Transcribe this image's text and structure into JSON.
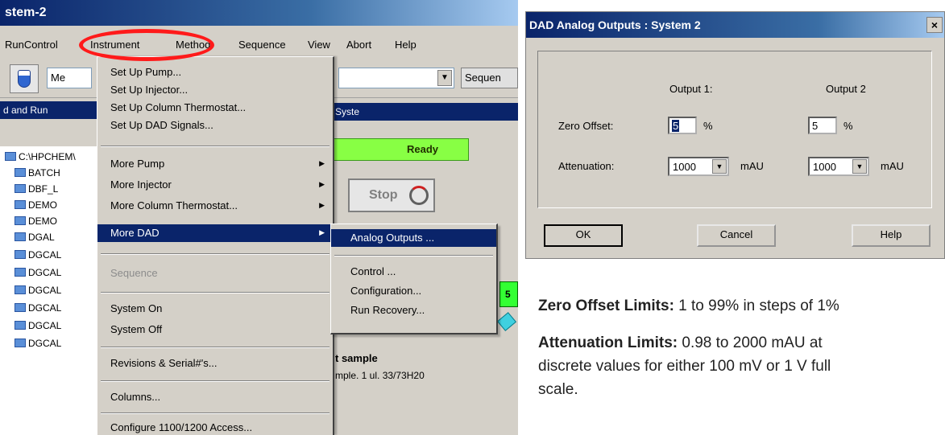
{
  "main_window": {
    "title": "stem-2",
    "menu": [
      "RunControl",
      "Instrument",
      "Method",
      "Sequence",
      "View",
      "Abort",
      "Help"
    ],
    "toolbar": {
      "method_combo": "Me",
      "sequence_button": "Sequen"
    },
    "left_panel_header": "d and Run",
    "right_panel_header": "Syste",
    "tree_items": [
      "C:\\HPCHEM\\",
      "BATCH",
      "DBF_L",
      "DEMO",
      "DEMO",
      "DGAL",
      "DGCAL",
      "DGCAL",
      "DGCAL",
      "DGCAL",
      "DGCAL",
      "DGCAL"
    ],
    "status": "Ready",
    "stop_label": "Stop",
    "green_indicator": "5",
    "sample_title": "t sample",
    "sample_detail": "mple. 1 ul. 33/73H20"
  },
  "instrument_menu": {
    "items": [
      {
        "label": "Set Up Pump...",
        "submenu": false,
        "disabled": false
      },
      {
        "label": "Set Up Injector...",
        "submenu": false,
        "disabled": false
      },
      {
        "label": "Set Up Column Thermostat...",
        "submenu": false,
        "disabled": false
      },
      {
        "label": "Set Up DAD Signals...",
        "submenu": false,
        "disabled": false
      },
      {
        "label": "More Pump",
        "submenu": true,
        "disabled": false
      },
      {
        "label": "More Injector",
        "submenu": true,
        "disabled": false
      },
      {
        "label": "More Column Thermostat...",
        "submenu": true,
        "disabled": false
      },
      {
        "label": "More DAD",
        "submenu": true,
        "disabled": false,
        "selected": true
      },
      {
        "label": "Sequence",
        "submenu": false,
        "disabled": true
      },
      {
        "label": "System On",
        "submenu": false,
        "disabled": false
      },
      {
        "label": "System Off",
        "submenu": false,
        "disabled": false
      },
      {
        "label": "Revisions & Serial#'s...",
        "submenu": false,
        "disabled": false
      },
      {
        "label": "Columns...",
        "submenu": false,
        "disabled": false
      },
      {
        "label": "Configure 1100/1200 Access...",
        "submenu": false,
        "disabled": false
      }
    ]
  },
  "more_dad_submenu": {
    "items": [
      "Analog Outputs ...",
      "Control ...",
      "Configuration...",
      "Run Recovery..."
    ]
  },
  "dialog": {
    "title": "DAD Analog Outputs : System 2",
    "close": "×",
    "col1": "Output 1:",
    "col2": "Output 2",
    "zero_offset_label": "Zero Offset:",
    "zero_offset_1": "5",
    "zero_offset_2": "5",
    "percent": "%",
    "attenuation_label": "Attenuation:",
    "attenuation_1": "1000",
    "attenuation_2": "1000",
    "unit": "mAU",
    "ok": "OK",
    "cancel": "Cancel",
    "help": "Help"
  },
  "notes": {
    "zero_title": "Zero Offset Limits:",
    "zero_text": " 1 to 99% in steps of 1%",
    "atten_title": "Attenuation Limits:",
    "atten_text": " 0.98 to 2000 mAU at",
    "atten_line2": "discrete values for either 100 mV or 1 V full",
    "atten_line3": "scale."
  },
  "colors": {
    "highlight_ellipse": "#ff1a1a",
    "titlebar": "#0a246a",
    "ready": "#88ff44"
  }
}
